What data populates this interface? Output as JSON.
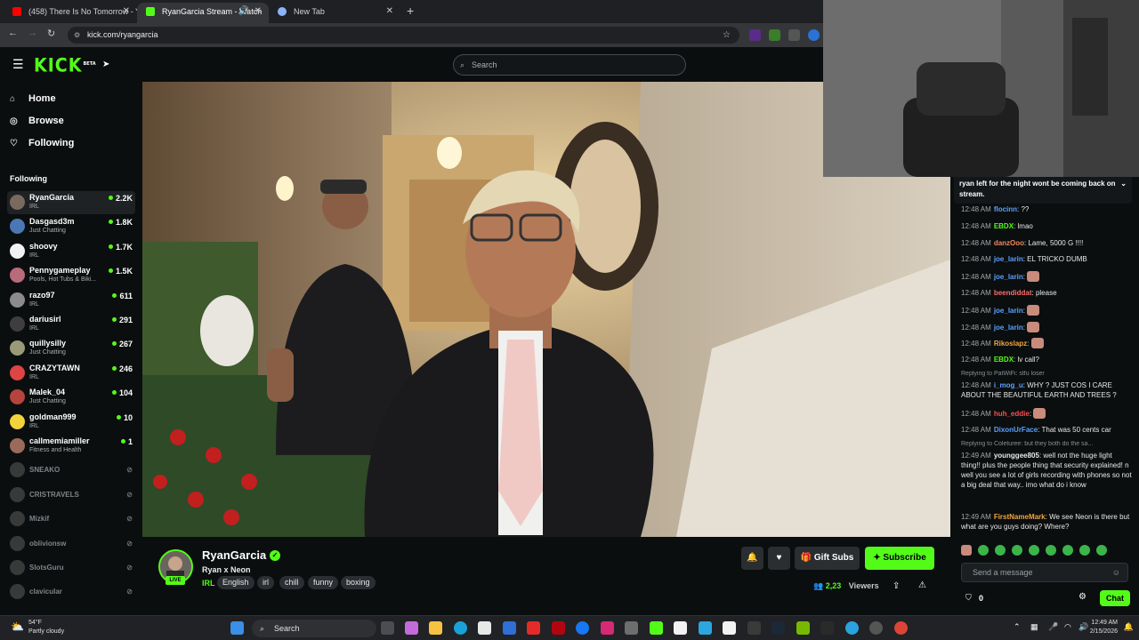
{
  "browser": {
    "tabs": [
      {
        "label": "(458) There Is No Tomorrow - Y",
        "favicon_color": "#ff0000"
      },
      {
        "label": "RyanGarcia Stream - Watch",
        "favicon_color": "#53fc18"
      },
      {
        "label": "New Tab",
        "favicon_color": "#8ab4f8"
      }
    ],
    "url": "kick.com/ryangarcia"
  },
  "kick": {
    "logo": "KICK",
    "logo_beta": "BETA",
    "search_placeholder": "Search",
    "nav": [
      {
        "label": "Home",
        "icon": "home-icon"
      },
      {
        "label": "Browse",
        "icon": "compass-icon"
      },
      {
        "label": "Following",
        "icon": "heart-icon"
      }
    ],
    "following_header": "Following",
    "channels": [
      {
        "name": "RyanGarcia",
        "category": "IRL",
        "viewers": "2.2K",
        "live": true,
        "color": "#7a6a5e"
      },
      {
        "name": "Dasgasd3m",
        "category": "Just Chatting",
        "viewers": "1.8K",
        "live": true,
        "color": "#4b78b5"
      },
      {
        "name": "shoovy",
        "category": "IRL",
        "viewers": "1.7K",
        "live": true,
        "color": "#f2f2f2"
      },
      {
        "name": "Pennygameplay",
        "category": "Pools, Hot Tubs & Biki...",
        "viewers": "1.5K",
        "live": true,
        "color": "#b86b7a"
      },
      {
        "name": "razo97",
        "category": "IRL",
        "viewers": "611",
        "live": true,
        "color": "#8b8b8b"
      },
      {
        "name": "dariusirl",
        "category": "IRL",
        "viewers": "291",
        "live": true,
        "color": "#3e3e3e"
      },
      {
        "name": "quillysilly",
        "category": "Just Chatting",
        "viewers": "267",
        "live": true,
        "color": "#9a9a7a"
      },
      {
        "name": "CRAZYTAWN",
        "category": "IRL",
        "viewers": "246",
        "live": true,
        "color": "#d44"
      },
      {
        "name": "Malek_04",
        "category": "Just Chatting",
        "viewers": "104",
        "live": true,
        "color": "#b5443c"
      },
      {
        "name": "goldman999",
        "category": "IRL",
        "viewers": "10",
        "live": true,
        "color": "#f2d33b"
      },
      {
        "name": "callmemiamiller",
        "category": "Fitness and Health",
        "viewers": "1",
        "live": true,
        "color": "#9b6a5b"
      },
      {
        "name": "SNEAKO",
        "category": "",
        "viewers": "",
        "live": false,
        "color": "#666"
      },
      {
        "name": "CRISTRAVELS",
        "category": "",
        "viewers": "",
        "live": false,
        "color": "#666"
      },
      {
        "name": "Mizkif",
        "category": "",
        "viewers": "",
        "live": false,
        "color": "#666"
      },
      {
        "name": "oblivionsw",
        "category": "",
        "viewers": "",
        "live": false,
        "color": "#666"
      },
      {
        "name": "SlotsGuru",
        "category": "",
        "viewers": "",
        "live": false,
        "color": "#666"
      },
      {
        "name": "clavicular",
        "category": "",
        "viewers": "",
        "live": false,
        "color": "#666"
      }
    ]
  },
  "stream": {
    "channel_name": "RyanGarcia",
    "live_label": "LIVE",
    "title": "Ryan x Neon",
    "category": "IRL",
    "tags": [
      "English",
      "irl",
      "chill",
      "funny",
      "boxing"
    ],
    "gift_label": "Gift Subs",
    "subscribe_label": "Subscribe",
    "viewer_count": "2,23",
    "viewers_label": "Viewers"
  },
  "chat": {
    "pinned": "ryan left for the night wont be coming back on stream.",
    "messages": [
      {
        "time": "12:48 AM",
        "user": "flocinn",
        "color": "#5aa0ff",
        "text": "??",
        "emote": false
      },
      {
        "time": "12:48 AM",
        "user": "EBDX",
        "color": "#53fc18",
        "text": "lmao",
        "emote": false
      },
      {
        "time": "12:48 AM",
        "user": "danzOoo",
        "color": "#f08a5d",
        "text": "Lame, 5000 G !!!!",
        "emote": false
      },
      {
        "time": "12:48 AM",
        "user": "joe_larin",
        "color": "#5aa0ff",
        "text": "EL TRICKO DUMB",
        "emote": false
      },
      {
        "time": "12:48 AM",
        "user": "joe_larin",
        "color": "#5aa0ff",
        "text": "",
        "emote": true
      },
      {
        "time": "12:48 AM",
        "user": "beendiddat",
        "color": "#ff6b6b",
        "text": "please",
        "emote": false
      },
      {
        "time": "12:48 AM",
        "user": "joe_larin",
        "color": "#5aa0ff",
        "text": "",
        "emote": true
      },
      {
        "time": "12:48 AM",
        "user": "joe_larin",
        "color": "#5aa0ff",
        "text": "",
        "emote": true
      },
      {
        "time": "12:48 AM",
        "user": "Rikoslapz",
        "color": "#f2a641",
        "text": "",
        "emote": true
      },
      {
        "time": "12:48 AM",
        "user": "EBDX",
        "color": "#53fc18",
        "text": "lv call?",
        "emote": false
      }
    ],
    "reply1": "Replying to PatWiFi: stfu loser",
    "msg_reply1": {
      "time": "12:48 AM",
      "user": "i_mog_u",
      "color": "#5aa0ff",
      "text": "WHY ? JUST COS I CARE ABOUT THE BEAUTIFUL EARTH AND TREES ?"
    },
    "msg_huh": {
      "time": "12:48 AM",
      "user": "huh_eddie",
      "color": "#ff4d4d",
      "text": ""
    },
    "msg_dixon": {
      "time": "12:48 AM",
      "user": "DixonUrFace",
      "color": "#5aa0ff",
      "text": "That was 50 cents car"
    },
    "reply2": "Replying to Coleturee: but they both do the sa...",
    "msg_reply2": {
      "time": "12:49 AM",
      "user": "younggee805",
      "color": "#e6e6e6",
      "text": "well not the huge light thing!! plus the people thing that security explained! n well you see a lot of girls recording with phones so not a big deal that way.. imo what do i know"
    },
    "msg_first": {
      "time": "12:49 AM",
      "user": "FirstNameMark",
      "color": "#f2a641",
      "text": "We see Neon is there but what are you guys doing? Where?"
    },
    "input_placeholder": "Send a message",
    "points": "0",
    "chat_button": "Chat"
  },
  "taskbar": {
    "weather_temp": "54°F",
    "weather_desc": "Partly cloudy",
    "search_label": "Search",
    "time": "12:49 AM",
    "date": "2/15/2026"
  }
}
